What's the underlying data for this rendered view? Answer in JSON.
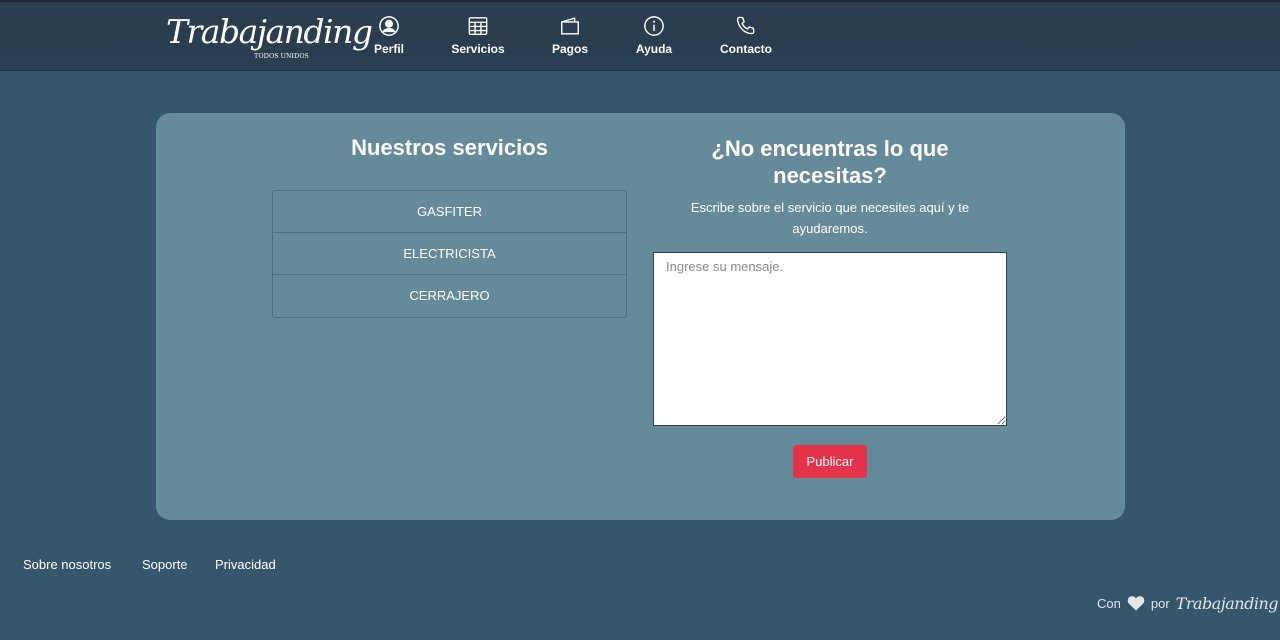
{
  "brand": {
    "name": "Trabajanding",
    "tagline": "TODOS UNIDOS"
  },
  "nav": {
    "items": [
      {
        "label": "Perfil",
        "icon": "user-circle-icon"
      },
      {
        "label": "Servicios",
        "icon": "table-grid-icon"
      },
      {
        "label": "Pagos",
        "icon": "wallet-icon"
      },
      {
        "label": "Ayuda",
        "icon": "info-circle-icon"
      },
      {
        "label": "Contacto",
        "icon": "phone-icon"
      }
    ]
  },
  "services": {
    "title": "Nuestros servicios",
    "items": [
      "GASFITER",
      "ELECTRICISTA",
      "CERRAJERO"
    ]
  },
  "help": {
    "title": "¿No encuentras lo que necesitas?",
    "subtitle": "Escribe sobre el servicio que necesites aquí y te ayudaremos.",
    "placeholder": "Ingrese su mensaje.",
    "value": "",
    "button_label": "Publicar"
  },
  "footer": {
    "links": [
      "Sobre nosotros",
      "Soporte",
      "Privacidad"
    ],
    "credit_prefix": "Con",
    "credit_middle": "por",
    "credit_brand": "Trabajanding",
    "heart_icon": "heart-icon"
  },
  "colors": {
    "page_bg": "#36566b",
    "navbar_bg": "#2b3d4e",
    "card_bg": "#658b9a",
    "accent": "#e53449"
  }
}
